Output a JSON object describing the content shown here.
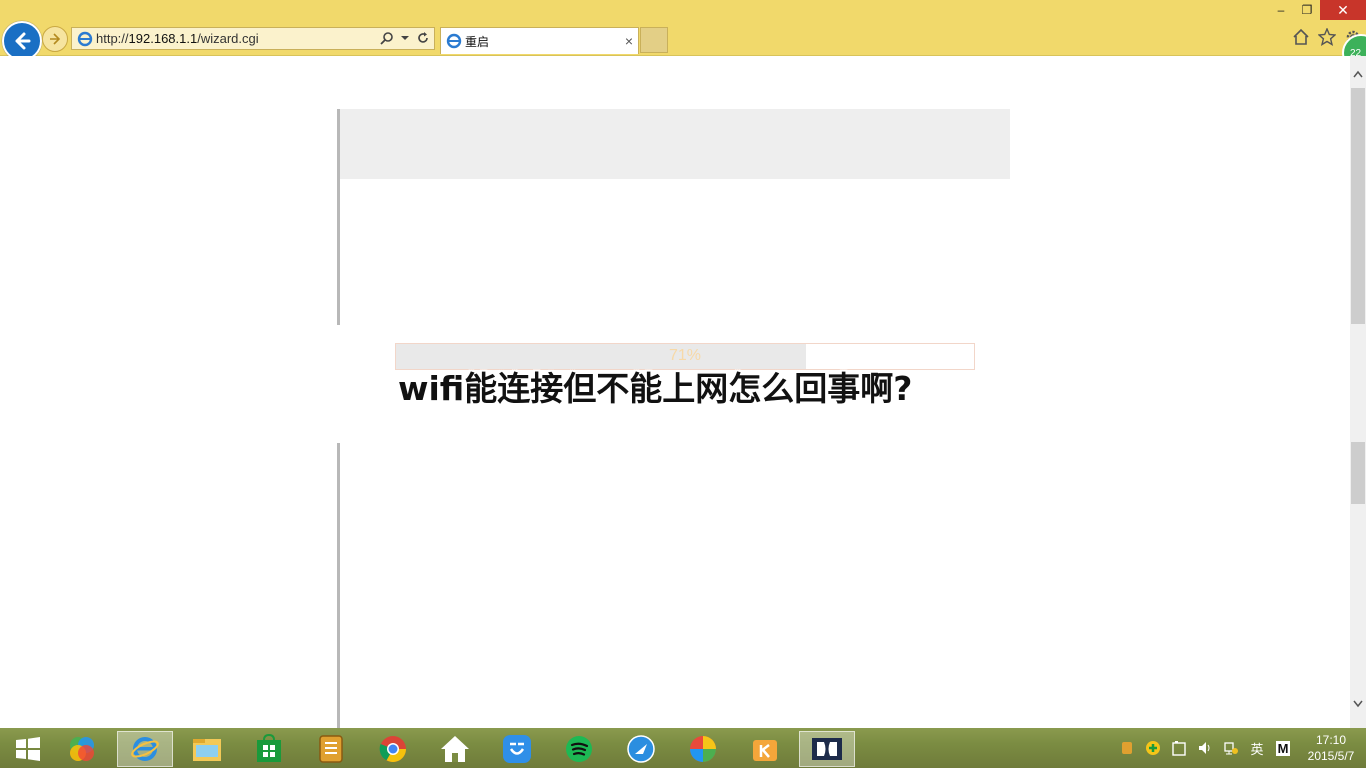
{
  "browser": {
    "address_url": "http://192.168.1.1/wizard.cgi",
    "url_prefix": "http://",
    "url_host": "192.168.1.1",
    "url_path": "/wizard.cgi",
    "tab_title": "重启",
    "tab_close": "×"
  },
  "window_controls": {
    "minimize": "–",
    "restore": "❐",
    "close": "✕"
  },
  "badge_text": "22",
  "page": {
    "progress_percent": 71,
    "progress_label": "71%",
    "note_text": "",
    "overlay_title": "wifi能连接但不能上网怎么回事啊?"
  },
  "taskbar": {
    "apps": [
      {
        "name": "start",
        "icon": "windows-icon"
      },
      {
        "name": "photos",
        "icon": "photos-icon"
      },
      {
        "name": "internet-explorer",
        "icon": "ie-icon",
        "active": true
      },
      {
        "name": "file-explorer",
        "icon": "folder-icon"
      },
      {
        "name": "store",
        "icon": "store-icon"
      },
      {
        "name": "notes",
        "icon": "notes-icon"
      },
      {
        "name": "chrome",
        "icon": "chrome-icon"
      },
      {
        "name": "home",
        "icon": "home-icon"
      },
      {
        "name": "app-blue",
        "icon": "app-blue-icon"
      },
      {
        "name": "spotify",
        "icon": "spotify-icon"
      },
      {
        "name": "messenger",
        "icon": "messenger-icon"
      },
      {
        "name": "colorful",
        "icon": "colorful-icon"
      },
      {
        "name": "kuaibo",
        "icon": "kuaibo-icon"
      },
      {
        "name": "dolby",
        "icon": "dolby-icon",
        "active": true
      }
    ],
    "tray_ime": "英",
    "tray_m": "M",
    "clock_time": "17:10",
    "clock_date": "2015/5/7"
  },
  "colors": {
    "chrome_bg": "#f1d96b",
    "back_button": "#1a6fc4",
    "close_button": "#c8352a",
    "progress_fill": "#e9e9e9",
    "progress_text": "#f7d9a8"
  }
}
